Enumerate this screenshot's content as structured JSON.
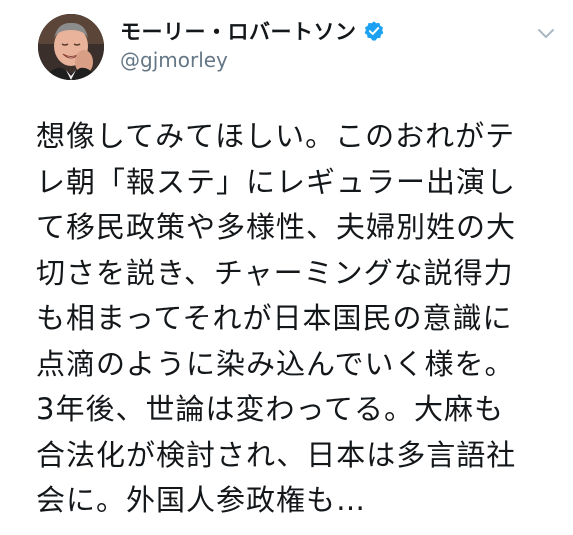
{
  "author": {
    "display_name": "モーリー・ロバートソン",
    "handle": "@gjmorley",
    "verified": true
  },
  "tweet": {
    "lines": [
      "想像してみてほしい。このおれがテ",
      "レ朝「報ステ」にレギュラー出演し",
      "て移民政策や多様性、夫婦別姓の大",
      "切さを説き、チャーミングな説得力",
      "も相まってそれが日本国民の意識に",
      "点滴のように染み込んでいく様を。",
      "3年後、世論は変わってる。大麻も",
      "合法化が検討され、日本は多言語社",
      "会に。外国人参政権も…"
    ]
  },
  "icons": {
    "verified": "verified-badge-icon",
    "menu": "chevron-down-icon"
  },
  "colors": {
    "text": "#14171a",
    "secondary_text": "#657786",
    "verified_blue": "#1da1f2",
    "chevron": "#aab8c2"
  }
}
